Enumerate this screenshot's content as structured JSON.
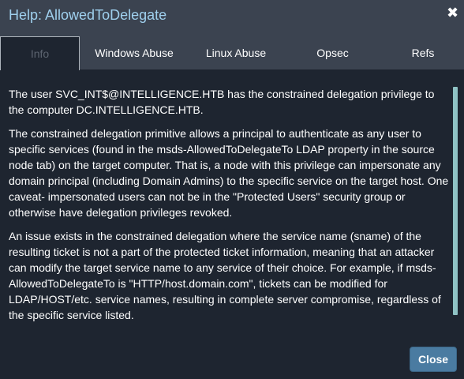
{
  "dialog": {
    "title": "Help: AllowedToDelegate",
    "close_icon": "close-icon",
    "close_glyph": "✖"
  },
  "tabs": [
    {
      "label": "Info",
      "active": true
    },
    {
      "label": "Windows Abuse",
      "active": false
    },
    {
      "label": "Linux Abuse",
      "active": false
    },
    {
      "label": "Opsec",
      "active": false
    },
    {
      "label": "Refs",
      "active": false
    }
  ],
  "content": {
    "paragraphs": [
      "The user SVC_INT$@INTELLIGENCE.HTB has the constrained delegation privilege to the computer DC.INTELLIGENCE.HTB.",
      "The constrained delegation primitive allows a principal to authenticate as any user to specific services (found in the msds-AllowedToDelegateTo LDAP property in the source node tab) on the target computer. That is, a node with this privilege can impersonate any domain principal (including Domain Admins) to the specific service on the target host. One caveat- impersonated users can not be in the \"Protected Users\" security group or otherwise have delegation privileges revoked.",
      "An issue exists in the constrained delegation where the service name (sname) of the resulting ticket is not a part of the protected ticket information, meaning that an attacker can modify the target service name to any service of their choice. For example, if msds-AllowedToDelegateTo is \"HTTP/host.domain.com\", tickets can be modified for LDAP/HOST/etc. service names, resulting in complete server compromise, regardless of the specific service listed."
    ]
  },
  "footer": {
    "close_label": "Close"
  },
  "colors": {
    "background": "#1e2530",
    "header": "#3b4350",
    "title": "#9fd0ee",
    "scrollbar": "#8fc2c4",
    "button": "#4a7ba1"
  }
}
